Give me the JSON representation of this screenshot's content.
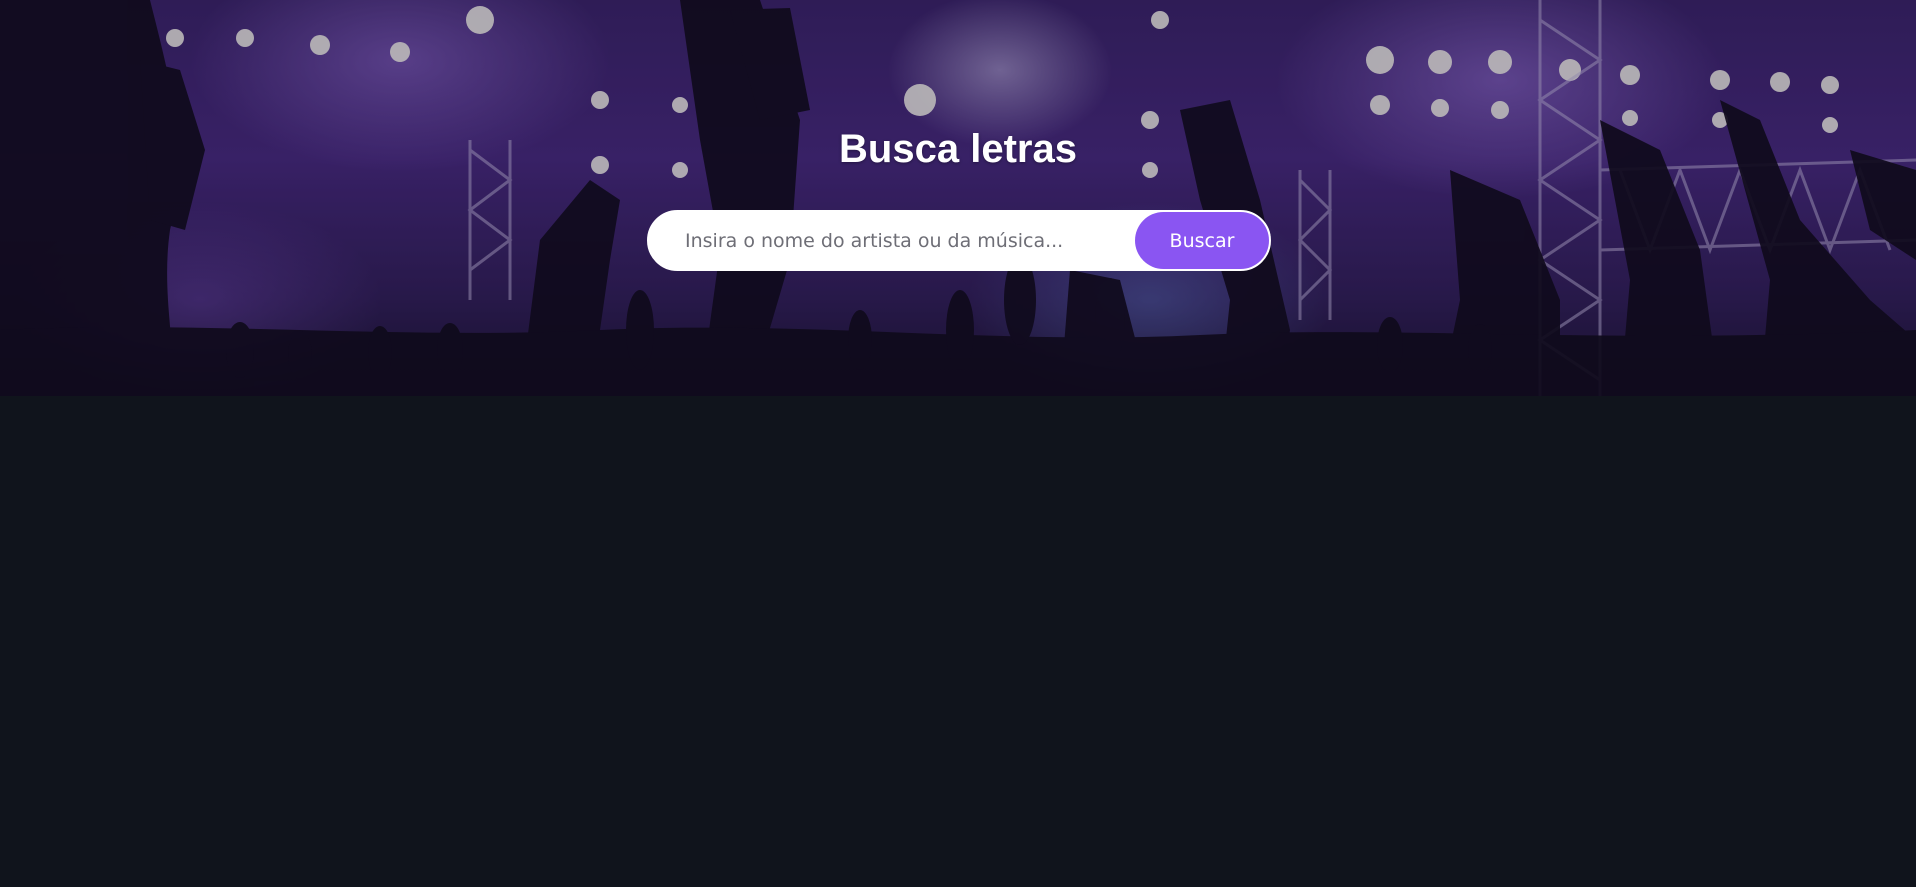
{
  "header": {
    "title": "Busca letras",
    "background_image": "concert-crowd"
  },
  "search": {
    "placeholder": "Insira o nome do artista ou da música...",
    "value": "",
    "button_label": "Buscar"
  },
  "colors": {
    "accent": "#8a55f2",
    "page_background": "#10141c",
    "title": "#ffffff"
  }
}
